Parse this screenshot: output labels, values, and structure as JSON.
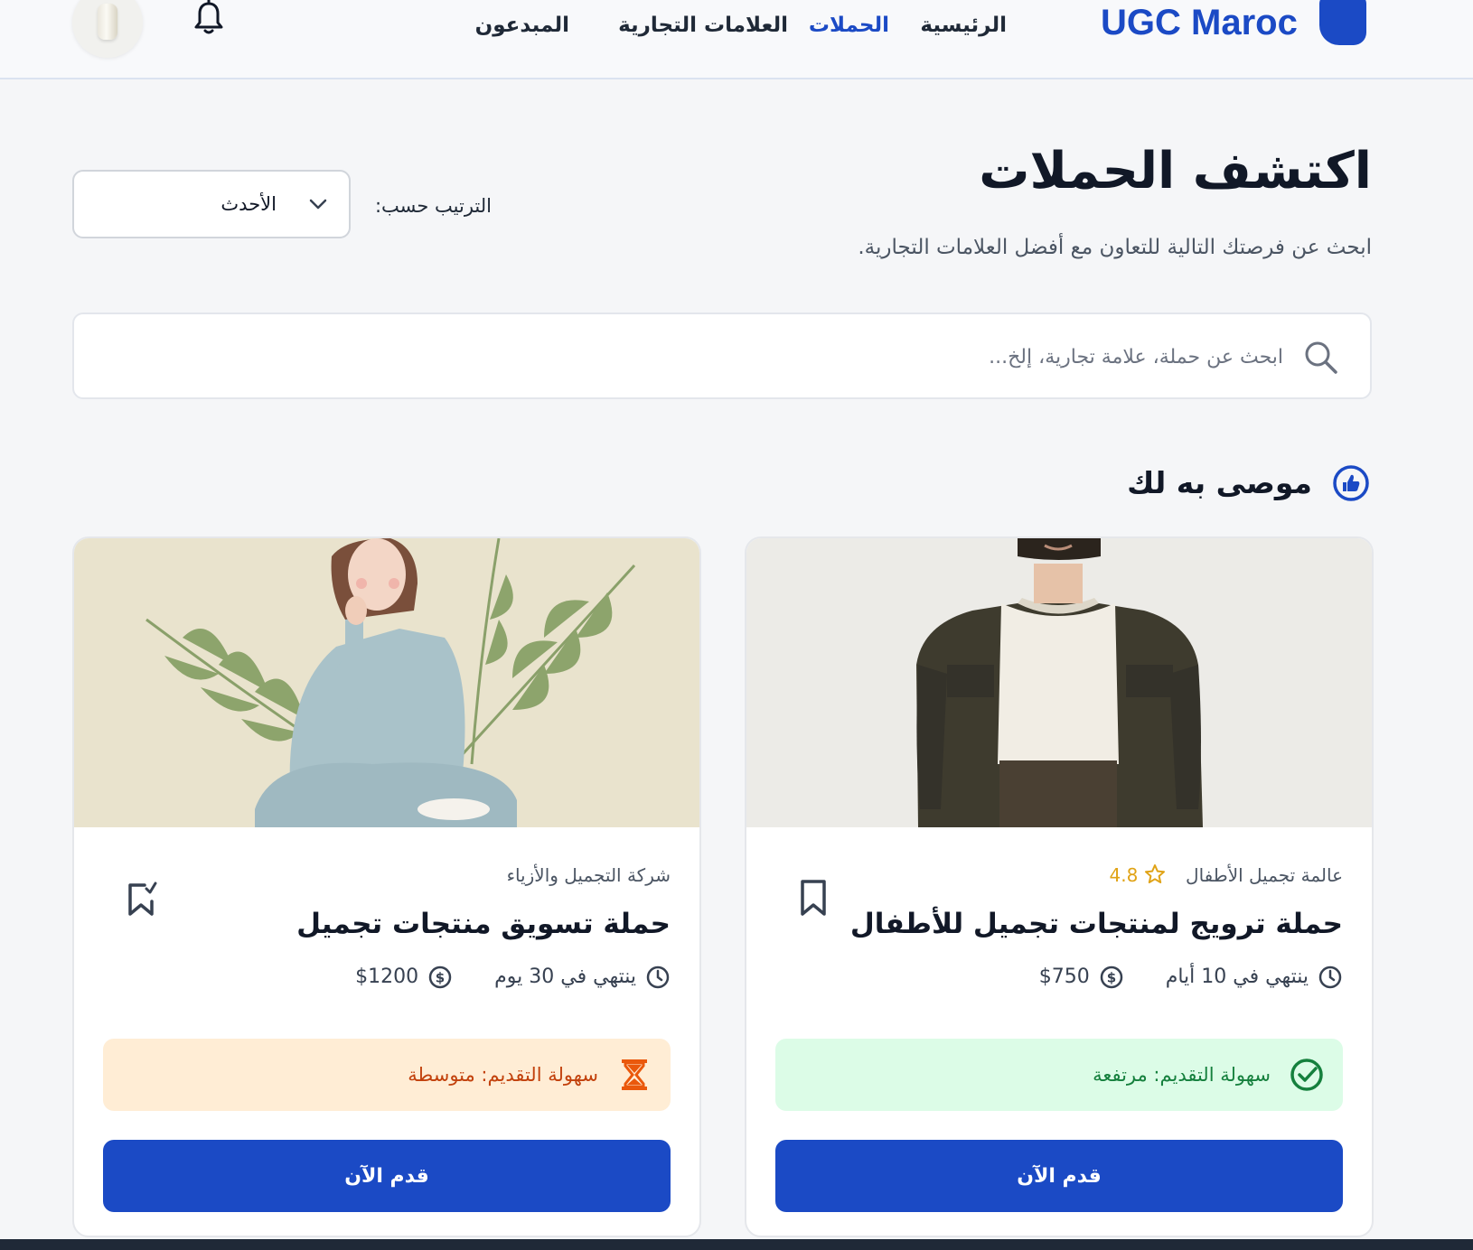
{
  "header": {
    "logo_text": "UGC Maroc",
    "nav": [
      {
        "label": "الرئيسية",
        "active": false
      },
      {
        "label": "الحملات",
        "active": true
      },
      {
        "label": "العلامات التجارية",
        "active": false
      },
      {
        "label": "المبدعون",
        "active": false
      }
    ]
  },
  "page": {
    "title": "اكتشف الحملات",
    "subtitle": "ابحث عن فرصتك التالية للتعاون مع أفضل العلامات التجارية.",
    "sort_label": "الترتيب حسب:",
    "sort_value": "الأحدث"
  },
  "search": {
    "placeholder": "ابحث عن حملة، علامة تجارية، إلخ..."
  },
  "section": {
    "title": "موصى به لك"
  },
  "cards": [
    {
      "brand": "عالمة تجميل الأطفال",
      "rating": "4.8",
      "title": "حملة ترويج لمنتجات تجميل للأطفال",
      "deadline": "ينتهي في 10 أيام",
      "budget": "$750",
      "ease": "سهولة التقديم: مرتفعة",
      "ease_level": "high",
      "apply_label": "قدم الآن"
    },
    {
      "brand": "شركة التجميل والأزياء",
      "title": "حملة تسويق منتجات تجميل",
      "deadline": "ينتهي في 30 يوم",
      "budget": "$1200",
      "ease": "سهولة التقديم: متوسطة",
      "ease_level": "medium",
      "apply_label": "قدم الآن"
    }
  ],
  "colors": {
    "accent": "#1b4ac5",
    "high_bg": "#dcfce7",
    "high_fg": "#15803d",
    "medium_bg": "#ffedd5",
    "medium_fg": "#c2410c",
    "rating": "#e0a316"
  }
}
